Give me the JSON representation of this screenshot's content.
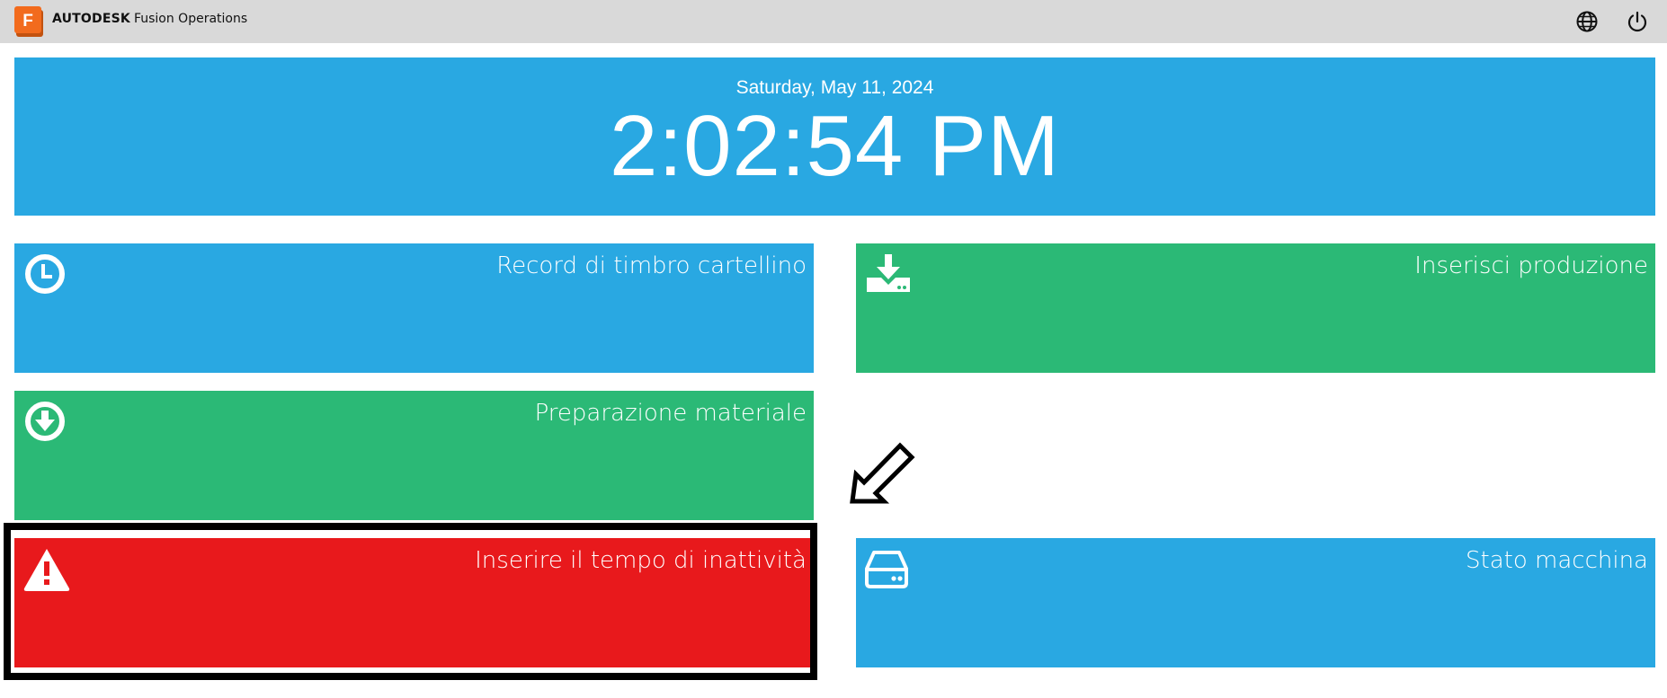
{
  "header": {
    "logo_letter": "F",
    "brand_bold": "AUTODESK",
    "brand_product": "Fusion Operations",
    "language_icon": "globe-icon",
    "power_icon": "power-icon"
  },
  "clock": {
    "date": "Saturday, May 11, 2024",
    "time": "2:02:54 PM"
  },
  "tiles": [
    {
      "label": "Record di timbro cartellino",
      "icon": "clock-icon",
      "color": "#29a8e2"
    },
    {
      "label": "Inserisci produzione",
      "icon": "download-tray-icon",
      "color": "#2bb976"
    },
    {
      "label": "Preparazione materiale",
      "icon": "arrow-down-circle-icon",
      "color": "#2bb976"
    },
    {
      "label": "Inserire il tempo di inattività",
      "icon": "warning-icon",
      "color": "#e8191c"
    },
    {
      "label": "Stato macchina",
      "icon": "hard-drive-icon",
      "color": "#29a8e2"
    }
  ],
  "colors": {
    "topbar": "#d9d9d9",
    "blue": "#29a8e2",
    "green": "#2bb976",
    "red": "#e8191c",
    "logo_orange": "#f26b1d"
  }
}
